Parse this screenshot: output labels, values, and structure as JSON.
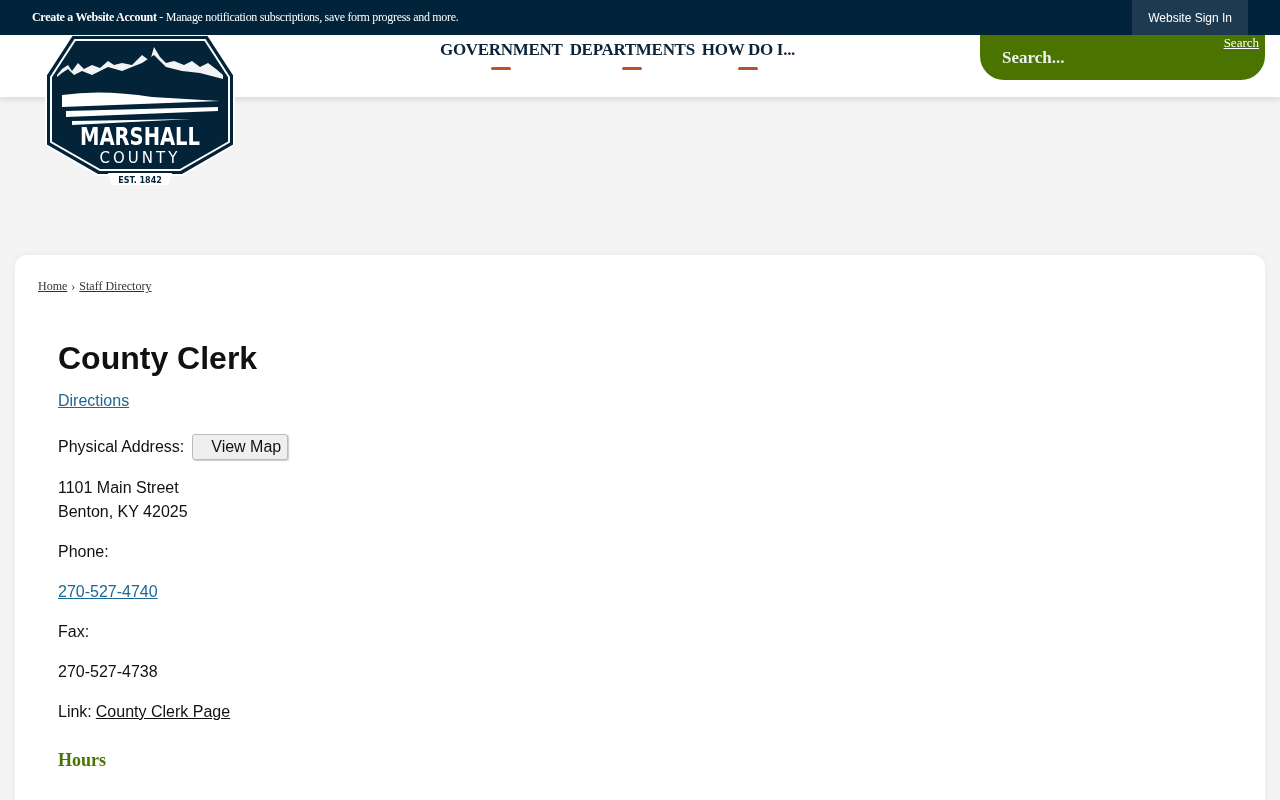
{
  "top_bar": {
    "notice_bold": "Create a Website Account",
    "notice_rest": " - Manage notification subscriptions, save form progress and more.",
    "sign_in": "Website Sign In"
  },
  "logo": {
    "line_1": "MARSHALL",
    "line_2": "COUNTY",
    "established": "EST. 1842"
  },
  "nav": [
    {
      "label": "GOVERNMENT"
    },
    {
      "label": "DEPARTMENTS"
    },
    {
      "label": "HOW DO I..."
    }
  ],
  "search": {
    "placeholder": "Search...",
    "button_alt": "Search"
  },
  "breadcrumb": [
    {
      "label": "Home"
    },
    {
      "label": "Staff Directory"
    }
  ],
  "breadcrumb_separator": "›",
  "title": "County Clerk",
  "directions": "Directions",
  "address_label": "Physical Address:",
  "view_map": "View Map",
  "address_lines": [
    "1101 Main Street",
    "Benton, KY 42025"
  ],
  "phone_label": "Phone:",
  "phone": "270-527-4740",
  "fax_label": "Fax:",
  "fax": "270-527-4738",
  "link_label": "Link:",
  "link": "County Clerk Page",
  "hours_heading": "Hours"
}
